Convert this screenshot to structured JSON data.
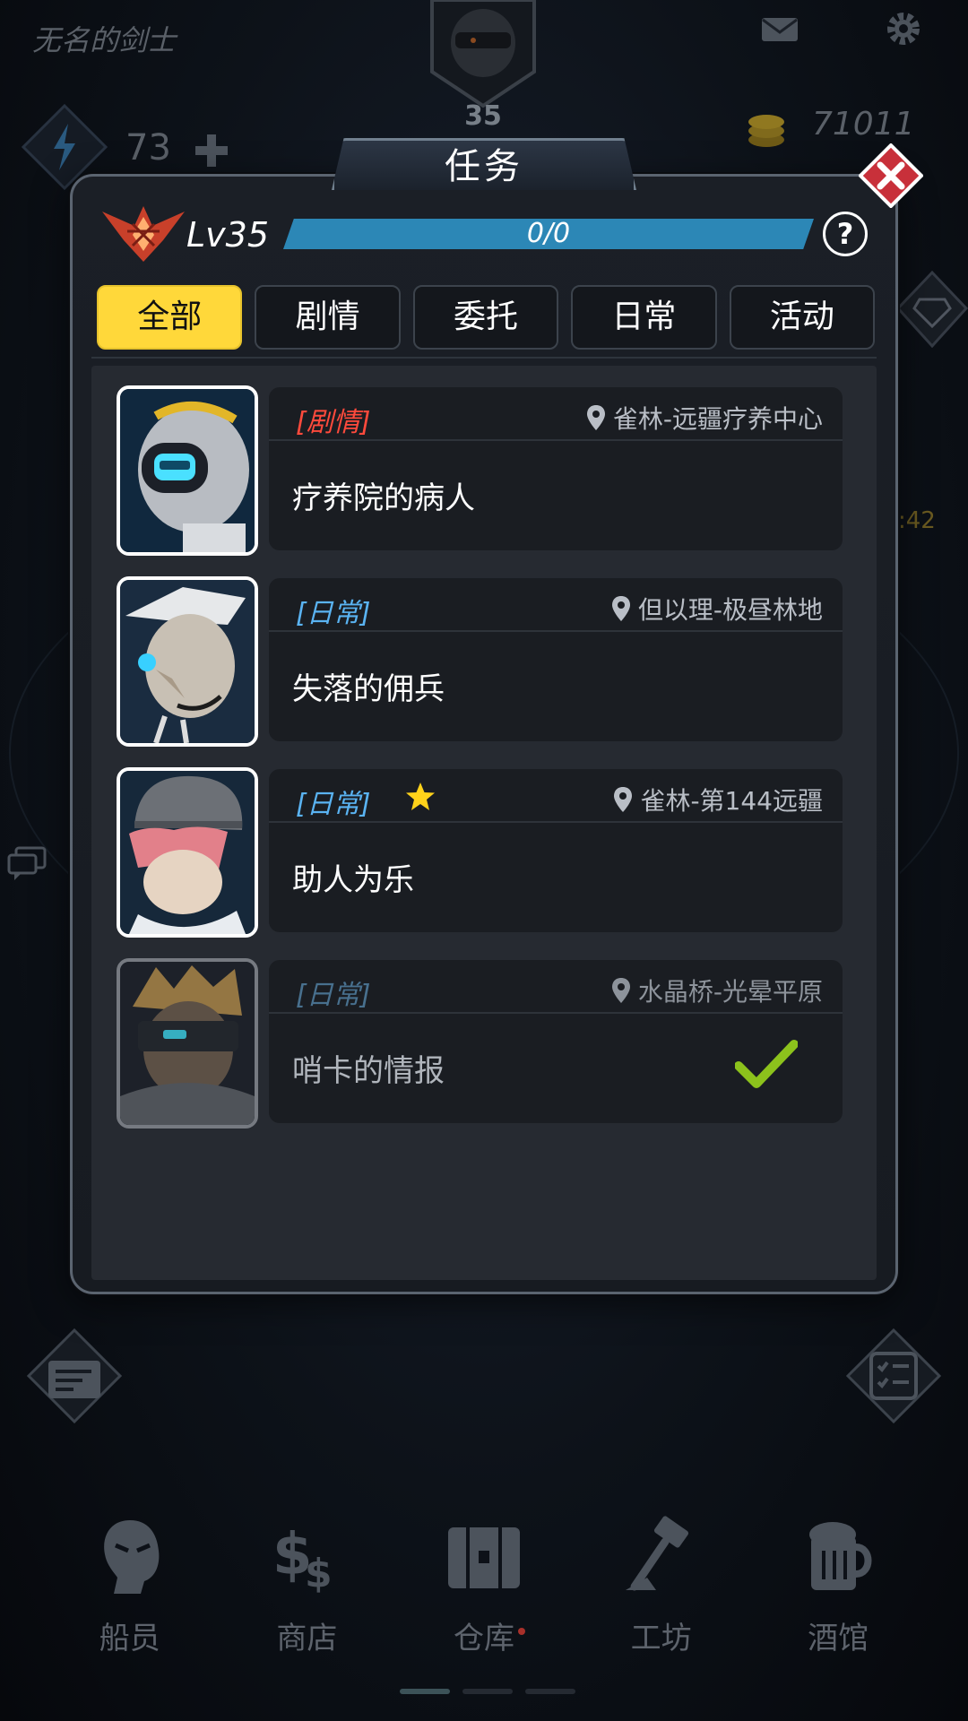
{
  "player": {
    "name": "无名的剑士",
    "level_badge": "35"
  },
  "resources": {
    "energy": "73",
    "coins": "71011",
    "timer_fragment": ":42"
  },
  "modal": {
    "title": "任务",
    "level_label": "Lv35",
    "progress_text": "0/0",
    "help_label": "?",
    "tabs": [
      "全部",
      "剧情",
      "委托",
      "日常",
      "活动"
    ],
    "active_tab": "全部"
  },
  "quests": [
    {
      "type": "[剧情]",
      "category": "story",
      "location": "雀林-远疆疗养中心",
      "name": "疗养院的病人",
      "starred": false,
      "completed": false
    },
    {
      "type": "[日常]",
      "category": "daily",
      "location": "但以理-极昼林地",
      "name": "失落的佣兵",
      "starred": false,
      "completed": false
    },
    {
      "type": "[日常]",
      "category": "daily",
      "location": "雀林-第144远疆",
      "name": "助人为乐",
      "starred": true,
      "completed": false
    },
    {
      "type": "[日常]",
      "category": "daily",
      "location": "水晶桥-光晕平原",
      "name": "哨卡的情报",
      "starred": false,
      "completed": true
    }
  ],
  "bottom_nav": [
    {
      "label": "船员",
      "icon": "crew-icon"
    },
    {
      "label": "商店",
      "icon": "shop-icon"
    },
    {
      "label": "仓库",
      "icon": "warehouse-icon",
      "notification": true
    },
    {
      "label": "工坊",
      "icon": "workshop-icon"
    },
    {
      "label": "酒馆",
      "icon": "tavern-icon"
    }
  ],
  "colors": {
    "active_tab": "#ffd83a",
    "story_tag": "#ff4a3c",
    "daily_tag": "#5ab3f2",
    "progress": "#2c87b6",
    "check": "#8cc21c",
    "close_button": "#c8303a"
  }
}
